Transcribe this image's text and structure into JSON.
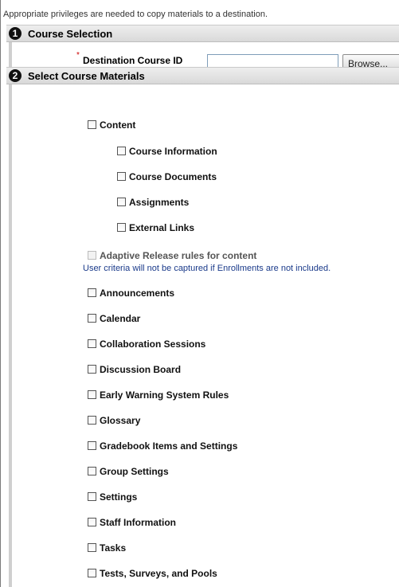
{
  "intro_text": "Appropriate privileges are needed to copy materials to a destination.",
  "step1": {
    "number": "1",
    "title": "Course Selection"
  },
  "destination": {
    "required_mark": "*",
    "label": "Destination Course ID",
    "value": "",
    "browse_label": "Browse..."
  },
  "step2": {
    "number": "2",
    "title": "Select Course Materials"
  },
  "content": {
    "label": "Content",
    "children": [
      "Course Information",
      "Course Documents",
      "Assignments",
      "External Links"
    ]
  },
  "adaptive_release": {
    "label": "Adaptive Release rules for content",
    "note": "User criteria will not be captured if Enrollments are not included."
  },
  "materials": [
    "Announcements",
    "Calendar",
    "Collaboration Sessions",
    "Discussion Board",
    "Early Warning System Rules",
    "Glossary",
    "Gradebook Items and Settings",
    "Group Settings",
    "Settings",
    "Staff Information",
    "Tasks",
    "Tests, Surveys, and Pools"
  ]
}
